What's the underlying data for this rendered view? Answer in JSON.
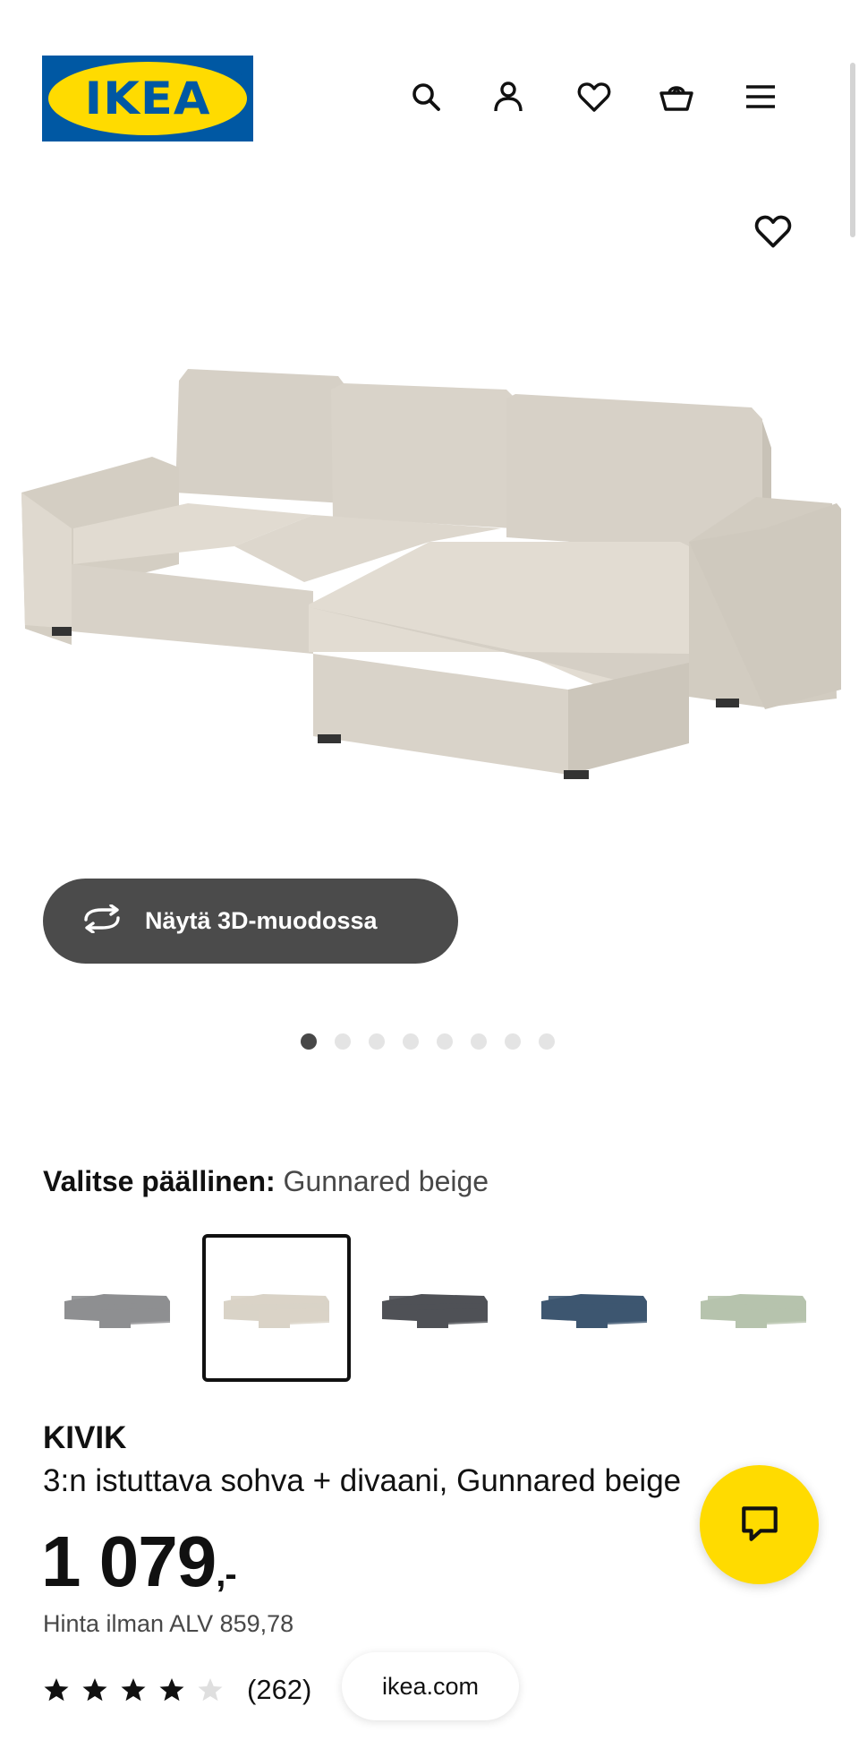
{
  "header": {
    "logo_text": "IKEA",
    "logo_reg": "®",
    "brand_blue": "#0058a3",
    "brand_yellow": "#ffdb00",
    "icons": [
      "search-icon",
      "profile-icon",
      "heart-icon",
      "basket-icon",
      "menu-icon"
    ]
  },
  "gallery": {
    "favorite_icon": "heart-icon",
    "view_3d_label": "Näytä 3D-muodossa",
    "view_3d_icon": "rotate-icon",
    "image_count": 8,
    "active_image": 1
  },
  "cover": {
    "label": "Valitse päällinen:",
    "selected": "Gunnared beige",
    "options": [
      {
        "name": "gray",
        "color": "#8e8f91"
      },
      {
        "name": "beige",
        "color": "#d9d3c7"
      },
      {
        "name": "dark-gray",
        "color": "#4f5156"
      },
      {
        "name": "blue",
        "color": "#3d5670"
      },
      {
        "name": "light-green",
        "color": "#b6c3ad"
      }
    ]
  },
  "product": {
    "name": "KIVIK",
    "description": "3:n istuttava sohva + divaani, Gunnared beige",
    "price_main": "1 079",
    "price_suffix": ",-",
    "vat_text": "Hinta ilman ALV 859,78",
    "rating": 4,
    "rating_max": 5,
    "review_count": "(262)"
  },
  "browser": {
    "url": "ikea.com"
  },
  "chat": {
    "icon": "chat-icon"
  }
}
